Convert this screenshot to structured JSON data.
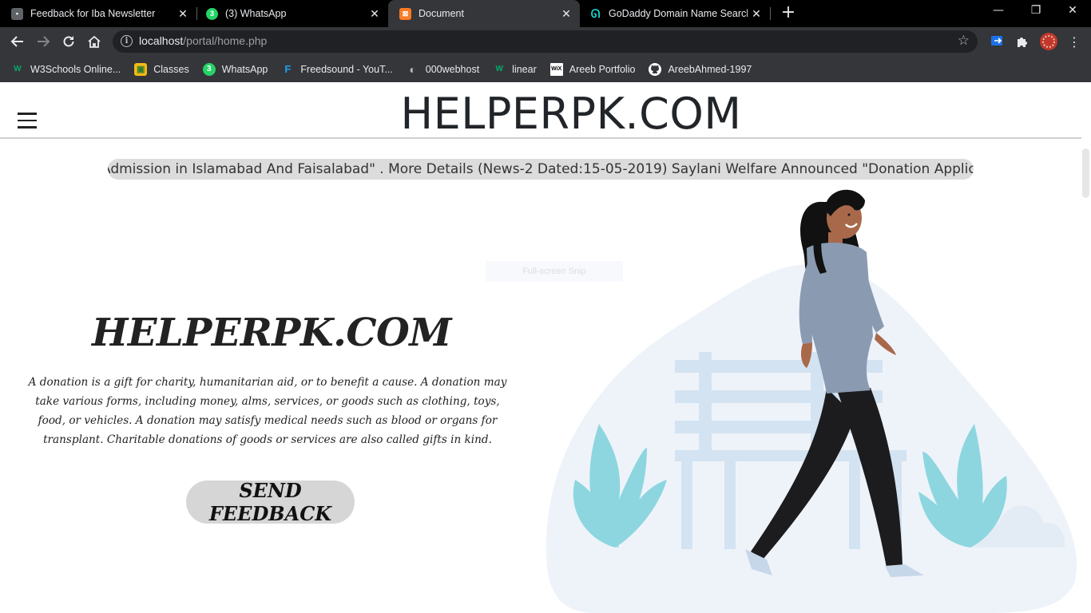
{
  "browser": {
    "tabs": [
      {
        "title": "Feedback for Iba Newsletter",
        "favicon_color": "#5f6368",
        "favicon_glyph": "▪"
      },
      {
        "title": "(3) WhatsApp",
        "favicon_color": "#25d366",
        "favicon_glyph": "3"
      },
      {
        "title": "Document",
        "favicon_color": "#fb7a24",
        "favicon_glyph": "⊠"
      },
      {
        "title": "GoDaddy Domain Name Search",
        "favicon_color": "#1bdbdb",
        "favicon_glyph": "G"
      }
    ],
    "active_tab_index": 2,
    "url_host": "localhost",
    "url_path": "/portal/home.php",
    "bookmarks": [
      {
        "label": "W3Schools Online...",
        "icon": "w3schools-icon",
        "color": "#04aa6d",
        "glyph": "W"
      },
      {
        "label": "Classes",
        "icon": "google-classroom-icon",
        "color": "#f5ba14",
        "glyph": "▣"
      },
      {
        "label": "WhatsApp",
        "icon": "whatsapp-icon",
        "color": "#25d366",
        "glyph": "3"
      },
      {
        "label": "Freedsound - YouT...",
        "icon": "freedsound-icon",
        "color": "#1da1f2",
        "glyph": "F"
      },
      {
        "label": "000webhost",
        "icon": "globe-icon",
        "color": "#bdc1c6",
        "glyph": "◐"
      },
      {
        "label": "linear",
        "icon": "w3schools-icon",
        "color": "#04aa6d",
        "glyph": "W"
      },
      {
        "label": "Areeb Portfolio",
        "icon": "wix-icon",
        "color": "#ffffff",
        "glyph": "WiX"
      },
      {
        "label": "AreebAhmed-1997",
        "icon": "github-icon",
        "color": "#ffffff",
        "glyph": "●"
      }
    ]
  },
  "page": {
    "site_title": "HELPERPK.COM",
    "news_ticker": "Admission in Islamabad And Faisalabad\" . More Details (News-2 Dated:15-05-2019) Saylani Welfare Announced \"Donation Application\" . More",
    "ghost_label": "Full-screen Snip",
    "hero_title": "HELPERPK.COM",
    "hero_text": "A donation is a gift for charity, humanitarian aid, or to benefit a cause. A donation may take various forms, including money, alms, services, or goods such as clothing, toys, food, or vehicles. A donation may satisfy medical needs such as blood or organs for transplant. Charitable donations of goods or services are also called gifts in kind.",
    "feedback_button": "SEND FEEDBACK"
  },
  "colors": {
    "chrome_dark": "#000000",
    "chrome_toolbar": "#35363a",
    "omnibox": "#202124",
    "ticker_bg": "#dcdcdc",
    "button_bg": "#d6d6d6",
    "blob": "#eef3fa",
    "bench": "#d4e3f1",
    "plant": "#8dd6df",
    "shirt": "#8a9bb1",
    "pants": "#1c1c1e",
    "skin": "#a8694a",
    "hair": "#111111"
  }
}
